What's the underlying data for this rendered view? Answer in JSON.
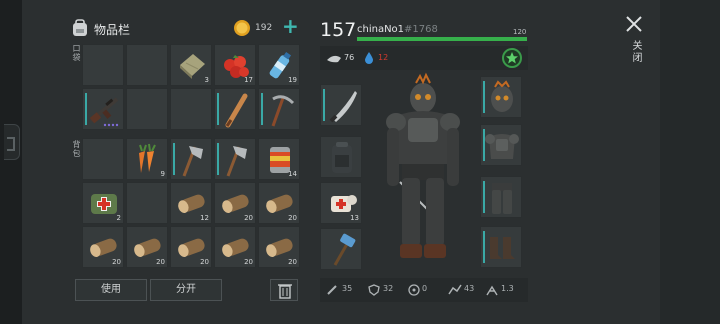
{
  "inventory": {
    "title": "物品栏",
    "coins": "192",
    "plus": "+",
    "pocket_label": "口袋",
    "backpack_label": "背包",
    "use_label": "使用",
    "split_label": "分开"
  },
  "slots": {
    "r1c3": "3",
    "r1c4": "17",
    "r1c5": "19",
    "r3c2": "9",
    "r3c5": "14",
    "r4c1": "2",
    "r4c3": "12",
    "r4c4": "20",
    "r4c5": "20",
    "r5c1": "20",
    "r5c2": "20",
    "r5c3": "20",
    "r5c4": "20",
    "r5c5": "20"
  },
  "icons": {
    "r1c3": "cloth-rag-icon",
    "r1c4": "berries-icon",
    "r1c5": "water-bottle-icon",
    "r2c1": "rifle-icon",
    "r2c4": "baseball-bat-icon",
    "r2c5": "pickaxe-icon",
    "r3c2": "carrot-icon",
    "r3c3": "hatchet-icon",
    "r3c4": "hatchet-icon",
    "r3c5": "canned-food-icon",
    "r4c1": "medkit-bag-icon",
    "log": "wood-log-icon"
  },
  "character": {
    "level": "157",
    "name": "chinaNo1",
    "id": "#1768",
    "hp": "120",
    "hp_fraction": 1.0,
    "food": "76",
    "water": "12",
    "equip_counts": {
      "bandage": "13"
    }
  },
  "stats": {
    "attack": "35",
    "defense": "32",
    "radiation": "0",
    "speed": "43",
    "stealth": "1.3"
  },
  "close": {
    "label": "关闭"
  },
  "colors": {
    "accent": "#3fb8b0",
    "hp": "#36b04b",
    "water": "#3b8fd6",
    "coin": "#e0a020"
  }
}
